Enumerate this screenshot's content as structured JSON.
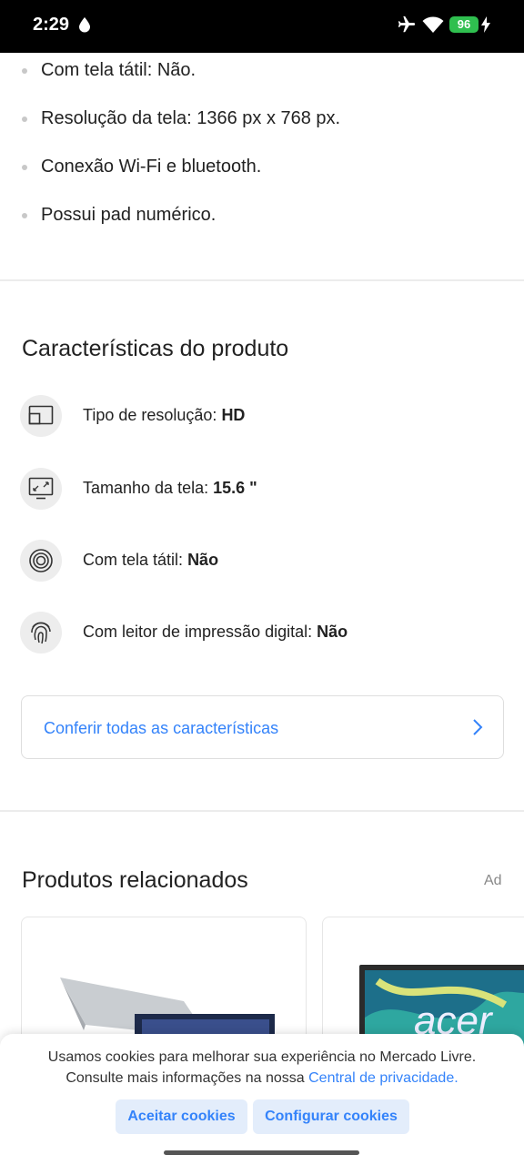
{
  "status_bar": {
    "time": "2:29",
    "battery": "96"
  },
  "bullets": [
    "Com tela tátil: Não.",
    "Resolução da tela: 1366 px x 768 px.",
    "Conexão Wi-Fi e bluetooth.",
    "Possui pad numérico."
  ],
  "characteristics": {
    "title": "Características do produto",
    "items": [
      {
        "label": "Tipo de resolução:",
        "value": "HD",
        "icon": "screen-resolution-icon"
      },
      {
        "label": "Tamanho da tela:",
        "value": "15.6 \"",
        "icon": "screen-size-icon"
      },
      {
        "label": "Com tela tátil:",
        "value": "Não",
        "icon": "touch-icon"
      },
      {
        "label": "Com leitor de impressão digital:",
        "value": "Não",
        "icon": "fingerprint-icon"
      }
    ],
    "see_all": "Conferir todas as características"
  },
  "related": {
    "title": "Produtos relacionados",
    "ad_label": "Ad"
  },
  "cookies": {
    "line1": "Usamos cookies para melhorar sua experiência no Mercado Livre.",
    "line2": "Consulte mais informações na nossa",
    "link": "Central de privacidade.",
    "accept": "Aceitar cookies",
    "configure": "Configurar cookies"
  }
}
